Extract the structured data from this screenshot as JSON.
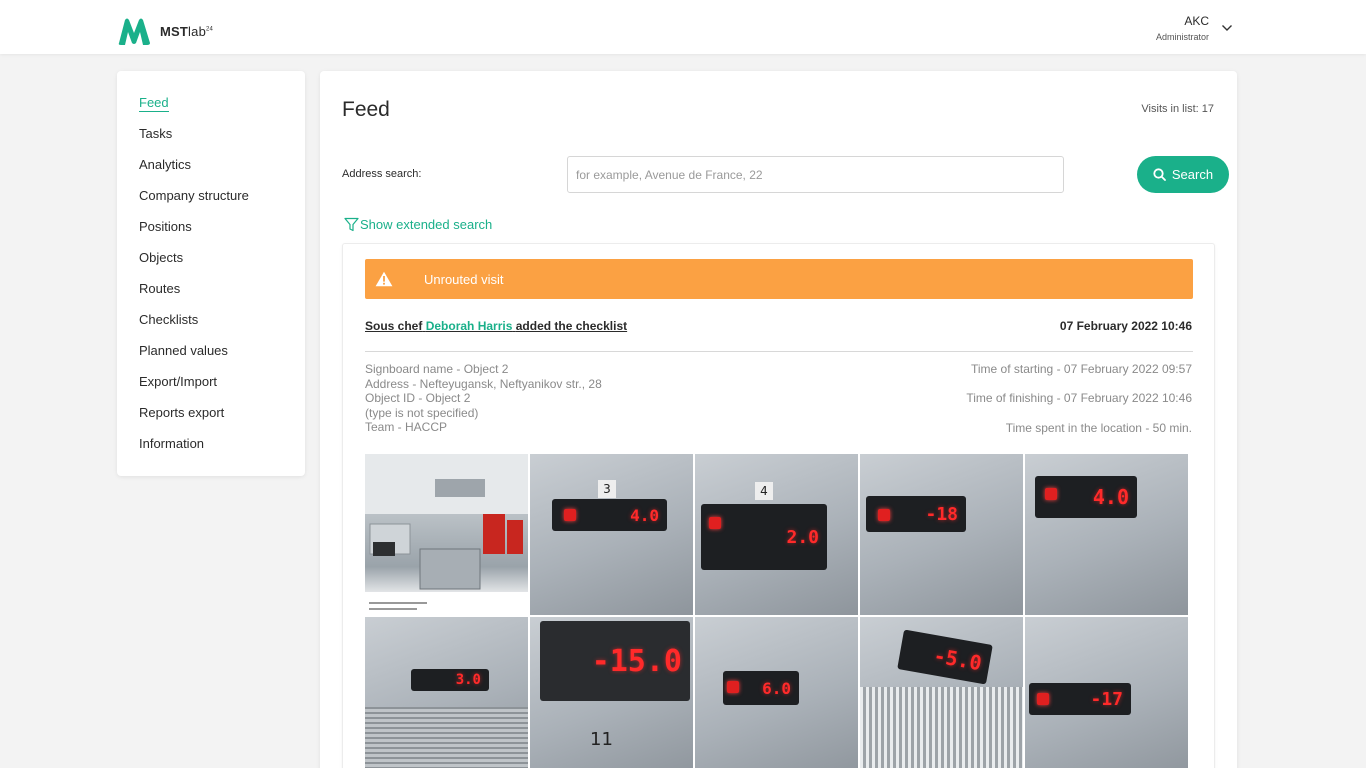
{
  "header": {
    "brand": "MST",
    "brand_suffix": "lab",
    "brand_sup": "24",
    "user_name": "AKC",
    "user_role": "Administrator"
  },
  "sidebar": {
    "items": [
      {
        "label": "Feed",
        "active": true
      },
      {
        "label": "Tasks"
      },
      {
        "label": "Analytics"
      },
      {
        "label": "Company structure"
      },
      {
        "label": "Positions"
      },
      {
        "label": "Objects"
      },
      {
        "label": "Routes"
      },
      {
        "label": "Checklists"
      },
      {
        "label": "Planned values"
      },
      {
        "label": "Export/Import"
      },
      {
        "label": "Reports export"
      },
      {
        "label": "Information"
      }
    ]
  },
  "main": {
    "title": "Feed",
    "visits_label": "Visits in list:",
    "visits_count": "17",
    "address_label": "Address search:",
    "address_placeholder": "for example, Avenue de France, 22",
    "address_value": "",
    "search_button": "Search",
    "extended_search": "Show extended search"
  },
  "visit": {
    "alert": "Unrouted visit",
    "role": "Sous chef",
    "person": "Deborah Harris",
    "action": "added the checklist",
    "datetime": "07 February 2022 10:46",
    "signboard": "Signboard name - Object 2",
    "address": "Address - Nefteyugansk, Neftyanikov str., 28",
    "object_id": "Object ID - Object 2",
    "object_type": "(type is not specified)",
    "team": "Team - HACCP",
    "time_start": "Time of starting - 07 February 2022 09:57",
    "time_finish": "Time of finishing - 07 February 2022 10:46",
    "time_spent": "Time spent in the location - 50 min.",
    "photos": [
      {
        "kind": "kitchen"
      },
      {
        "kind": "display",
        "reading": "4.0",
        "label": "3"
      },
      {
        "kind": "display",
        "reading": "2.0",
        "label": "4"
      },
      {
        "kind": "display",
        "reading": "-18"
      },
      {
        "kind": "display",
        "reading": "4.0"
      },
      {
        "kind": "display",
        "reading": "3.0"
      },
      {
        "kind": "display",
        "reading": "-15.0",
        "label": "11"
      },
      {
        "kind": "display",
        "reading": "6.0"
      },
      {
        "kind": "display",
        "reading": "-5.0"
      },
      {
        "kind": "display",
        "reading": "-17"
      }
    ]
  },
  "colors": {
    "accent": "#1ab08a",
    "alert": "#fba143",
    "display_red": "#ff2a2a"
  }
}
